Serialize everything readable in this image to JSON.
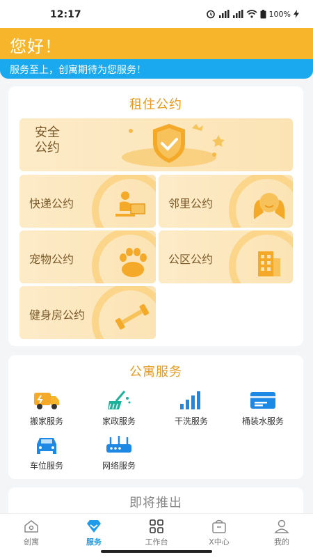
{
  "status_bar": {
    "time": "12:17",
    "battery": "100%"
  },
  "header": {
    "greeting": "您好！",
    "tagline": "服务至上，创寓期待为您服务！"
  },
  "rental_rules": {
    "title": "租住公约",
    "banner_label": "安全\n公约",
    "items": [
      {
        "label": "快递公约",
        "icon": "package-delivery-icon"
      },
      {
        "label": "邻里公约",
        "icon": "neighbor-icon"
      },
      {
        "label": "宠物公约",
        "icon": "paw-icon"
      },
      {
        "label": "公区公约",
        "icon": "building-icon"
      },
      {
        "label": "健身房公约",
        "icon": "dumbbell-icon"
      }
    ]
  },
  "apartment_services": {
    "title": "公寓服务",
    "items": [
      {
        "label": "搬家服务",
        "icon": "truck-icon"
      },
      {
        "label": "家政服务",
        "icon": "broom-icon"
      },
      {
        "label": "干洗服务",
        "icon": "bars-icon"
      },
      {
        "label": "桶装水服务",
        "icon": "water-card-icon"
      },
      {
        "label": "车位服务",
        "icon": "car-icon"
      },
      {
        "label": "网络服务",
        "icon": "router-icon"
      }
    ]
  },
  "coming_soon": {
    "title": "即将推出"
  },
  "tabbar": {
    "tabs": [
      {
        "label": "创寓",
        "icon": "home-icon"
      },
      {
        "label": "服务",
        "icon": "diamond-icon",
        "active": true
      },
      {
        "label": "工作台",
        "icon": "grid-icon"
      },
      {
        "label": "X中心",
        "icon": "bag-icon"
      },
      {
        "label": "我的",
        "icon": "user-icon"
      }
    ]
  },
  "colors": {
    "accent_orange": "#f7b52b",
    "accent_blue": "#1aa9ee",
    "tab_active": "#1e9bea"
  }
}
